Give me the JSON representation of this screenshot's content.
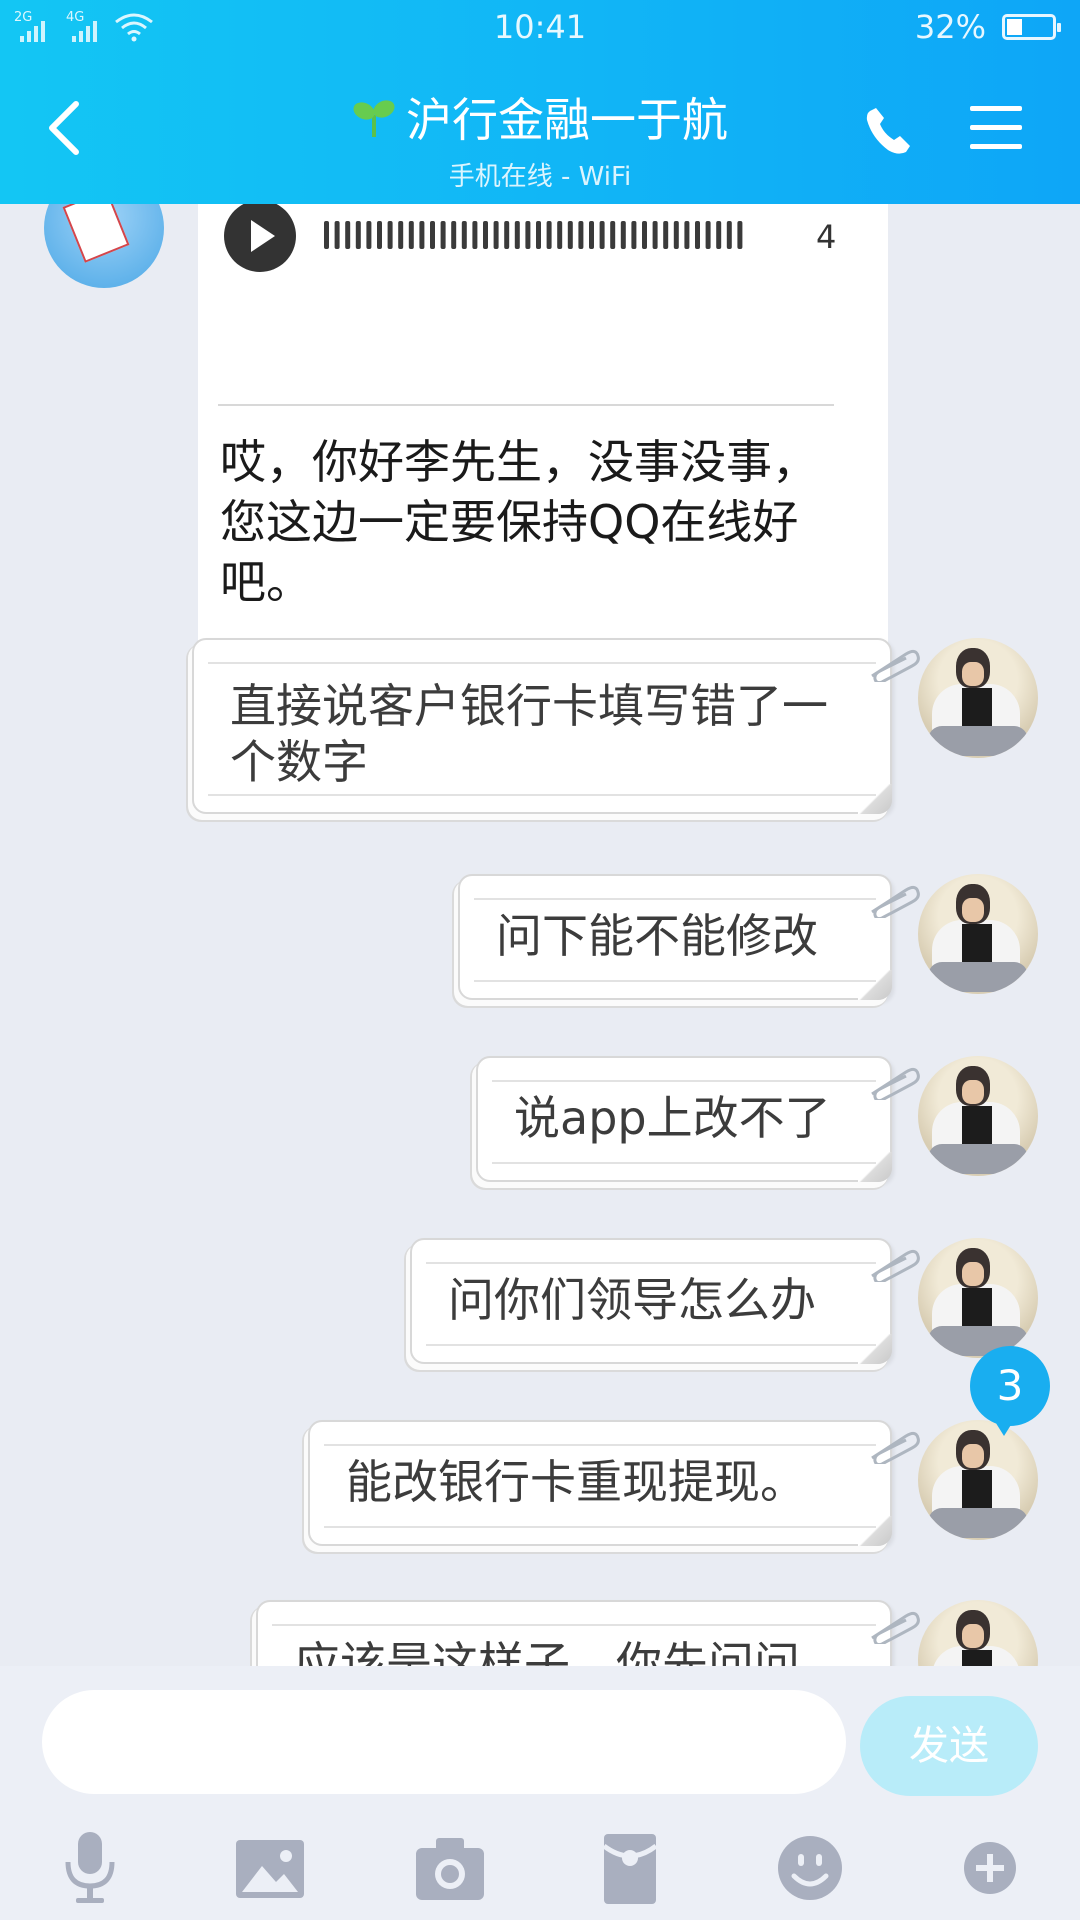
{
  "status_bar": {
    "network_1": "2G",
    "network_2": "4G",
    "time": "10:41",
    "battery": "32%"
  },
  "header": {
    "title": "沪行金融一于航",
    "subtitle": "手机在线 - WiFi"
  },
  "voice_message": {
    "duration": "4",
    "transcript": "哎，你好李先生，没事没事，您这边一定要保持QQ在线好吧。"
  },
  "messages": [
    {
      "text": "直接说客户银行卡填写错了一个数字"
    },
    {
      "text": "问下能不能修改"
    },
    {
      "text": "说app上改不了"
    },
    {
      "text": "问你们领导怎么办"
    },
    {
      "text": "能改银行卡重现提现。"
    },
    {
      "text": "应该是这样子，你先问问"
    }
  ],
  "unread_badge": "3",
  "composer": {
    "input_value": "",
    "send_label": "发送"
  },
  "toolbar": {
    "icons": [
      "microphone-icon",
      "image-icon",
      "camera-icon",
      "red-packet-icon",
      "emoji-icon",
      "plus-icon"
    ]
  },
  "colors": {
    "header_accent": "#13c6f4",
    "send_button": "#b8ecf9",
    "badge": "#19aef0"
  }
}
